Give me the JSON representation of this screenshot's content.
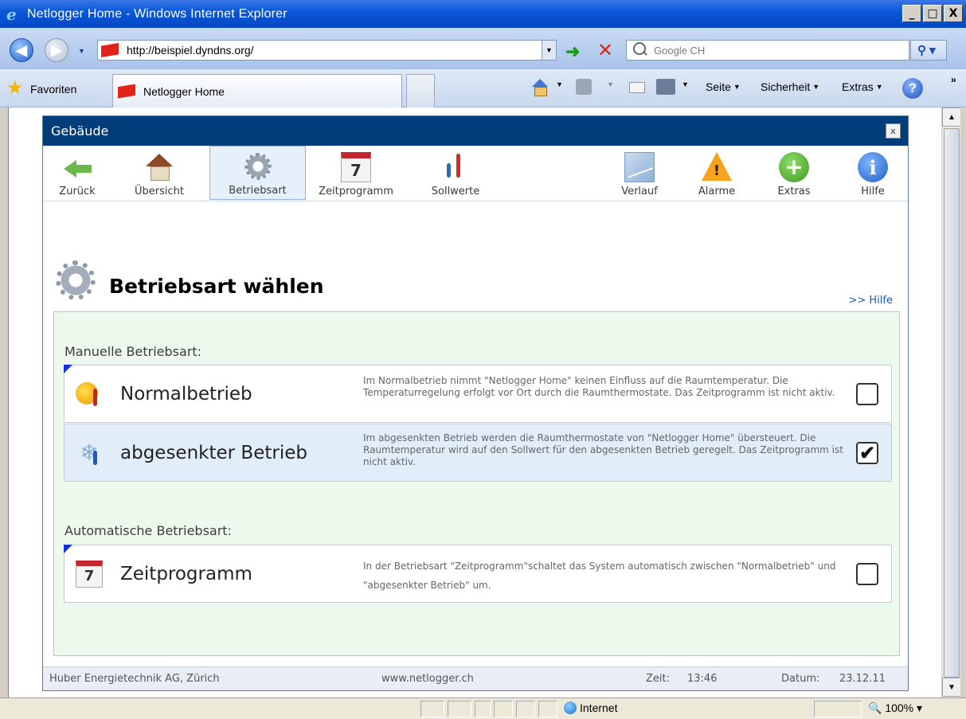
{
  "window": {
    "title": "Netlogger Home - Windows Internet Explorer",
    "btn_min": "_",
    "btn_max": "□",
    "btn_close": "X"
  },
  "addressbar": {
    "url": "http://beispiel.dyndns.org/",
    "search_placeholder": "Google CH"
  },
  "commandbar": {
    "favorites_label": "Favoriten",
    "tab_title": "Netlogger Home",
    "page_label": "Seite",
    "security_label": "Sicherheit",
    "extras_label": "Extras"
  },
  "app": {
    "title": "Gebäude",
    "close": "x",
    "toolbar": [
      {
        "label": "Zurück",
        "icon": "back-arrow-icon"
      },
      {
        "label": "Übersicht",
        "icon": "house-icon"
      },
      {
        "label": "Betriebsart",
        "icon": "gear-icon",
        "active": true
      },
      {
        "label": "Zeitprogramm",
        "icon": "calendar-icon"
      },
      {
        "label": "Sollwerte",
        "icon": "thermometer-icon"
      },
      {
        "label": "Verlauf",
        "icon": "chart-icon"
      },
      {
        "label": "Alarme",
        "icon": "warning-icon"
      },
      {
        "label": "Extras",
        "icon": "plus-icon"
      },
      {
        "label": "Hilfe",
        "icon": "info-icon"
      }
    ],
    "calendar_day": "7",
    "heading": "Betriebsart wählen",
    "help_link": ">> Hilfe",
    "manual_section": "Manuelle Betriebsart:",
    "auto_section": "Automatische Betriebsart:",
    "options": [
      {
        "title": "Normalbetrieb",
        "desc": "Im Normalbetrieb nimmt \"Netlogger Home\" keinen Einfluss auf die Raumtemperatur. Die Temperaturregelung erfolgt vor Ort durch die Raumthermostate. Das Zeitprogramm ist nicht aktiv.",
        "checked": false
      },
      {
        "title": "abgesenkter Betrieb",
        "desc": "Im abgesenkten Betrieb werden die Raumthermostate von \"Netlogger Home\" übersteuert. Die Raumtemperatur wird auf den Sollwert für den abgesenkten Betrieb geregelt. Das Zeitprogramm ist nicht aktiv.",
        "checked": true,
        "check_mark": "✔"
      },
      {
        "title": "Zeitprogramm",
        "desc": "In der Betriebsart \"Zeitprogramm\"schaltet das System automatisch zwischen \"Normalbetrieb\" und \"abgesenkter Betrieb\" um.",
        "checked": false
      }
    ],
    "footer": {
      "company": "Huber Energietechnik AG, Zürich",
      "website": "www.netlogger.ch",
      "time_label": "Zeit:",
      "time": "13:46",
      "date_label": "Datum:",
      "date": "23.12.11"
    }
  },
  "statusbar": {
    "zone": "Internet",
    "zoom": "100%"
  }
}
